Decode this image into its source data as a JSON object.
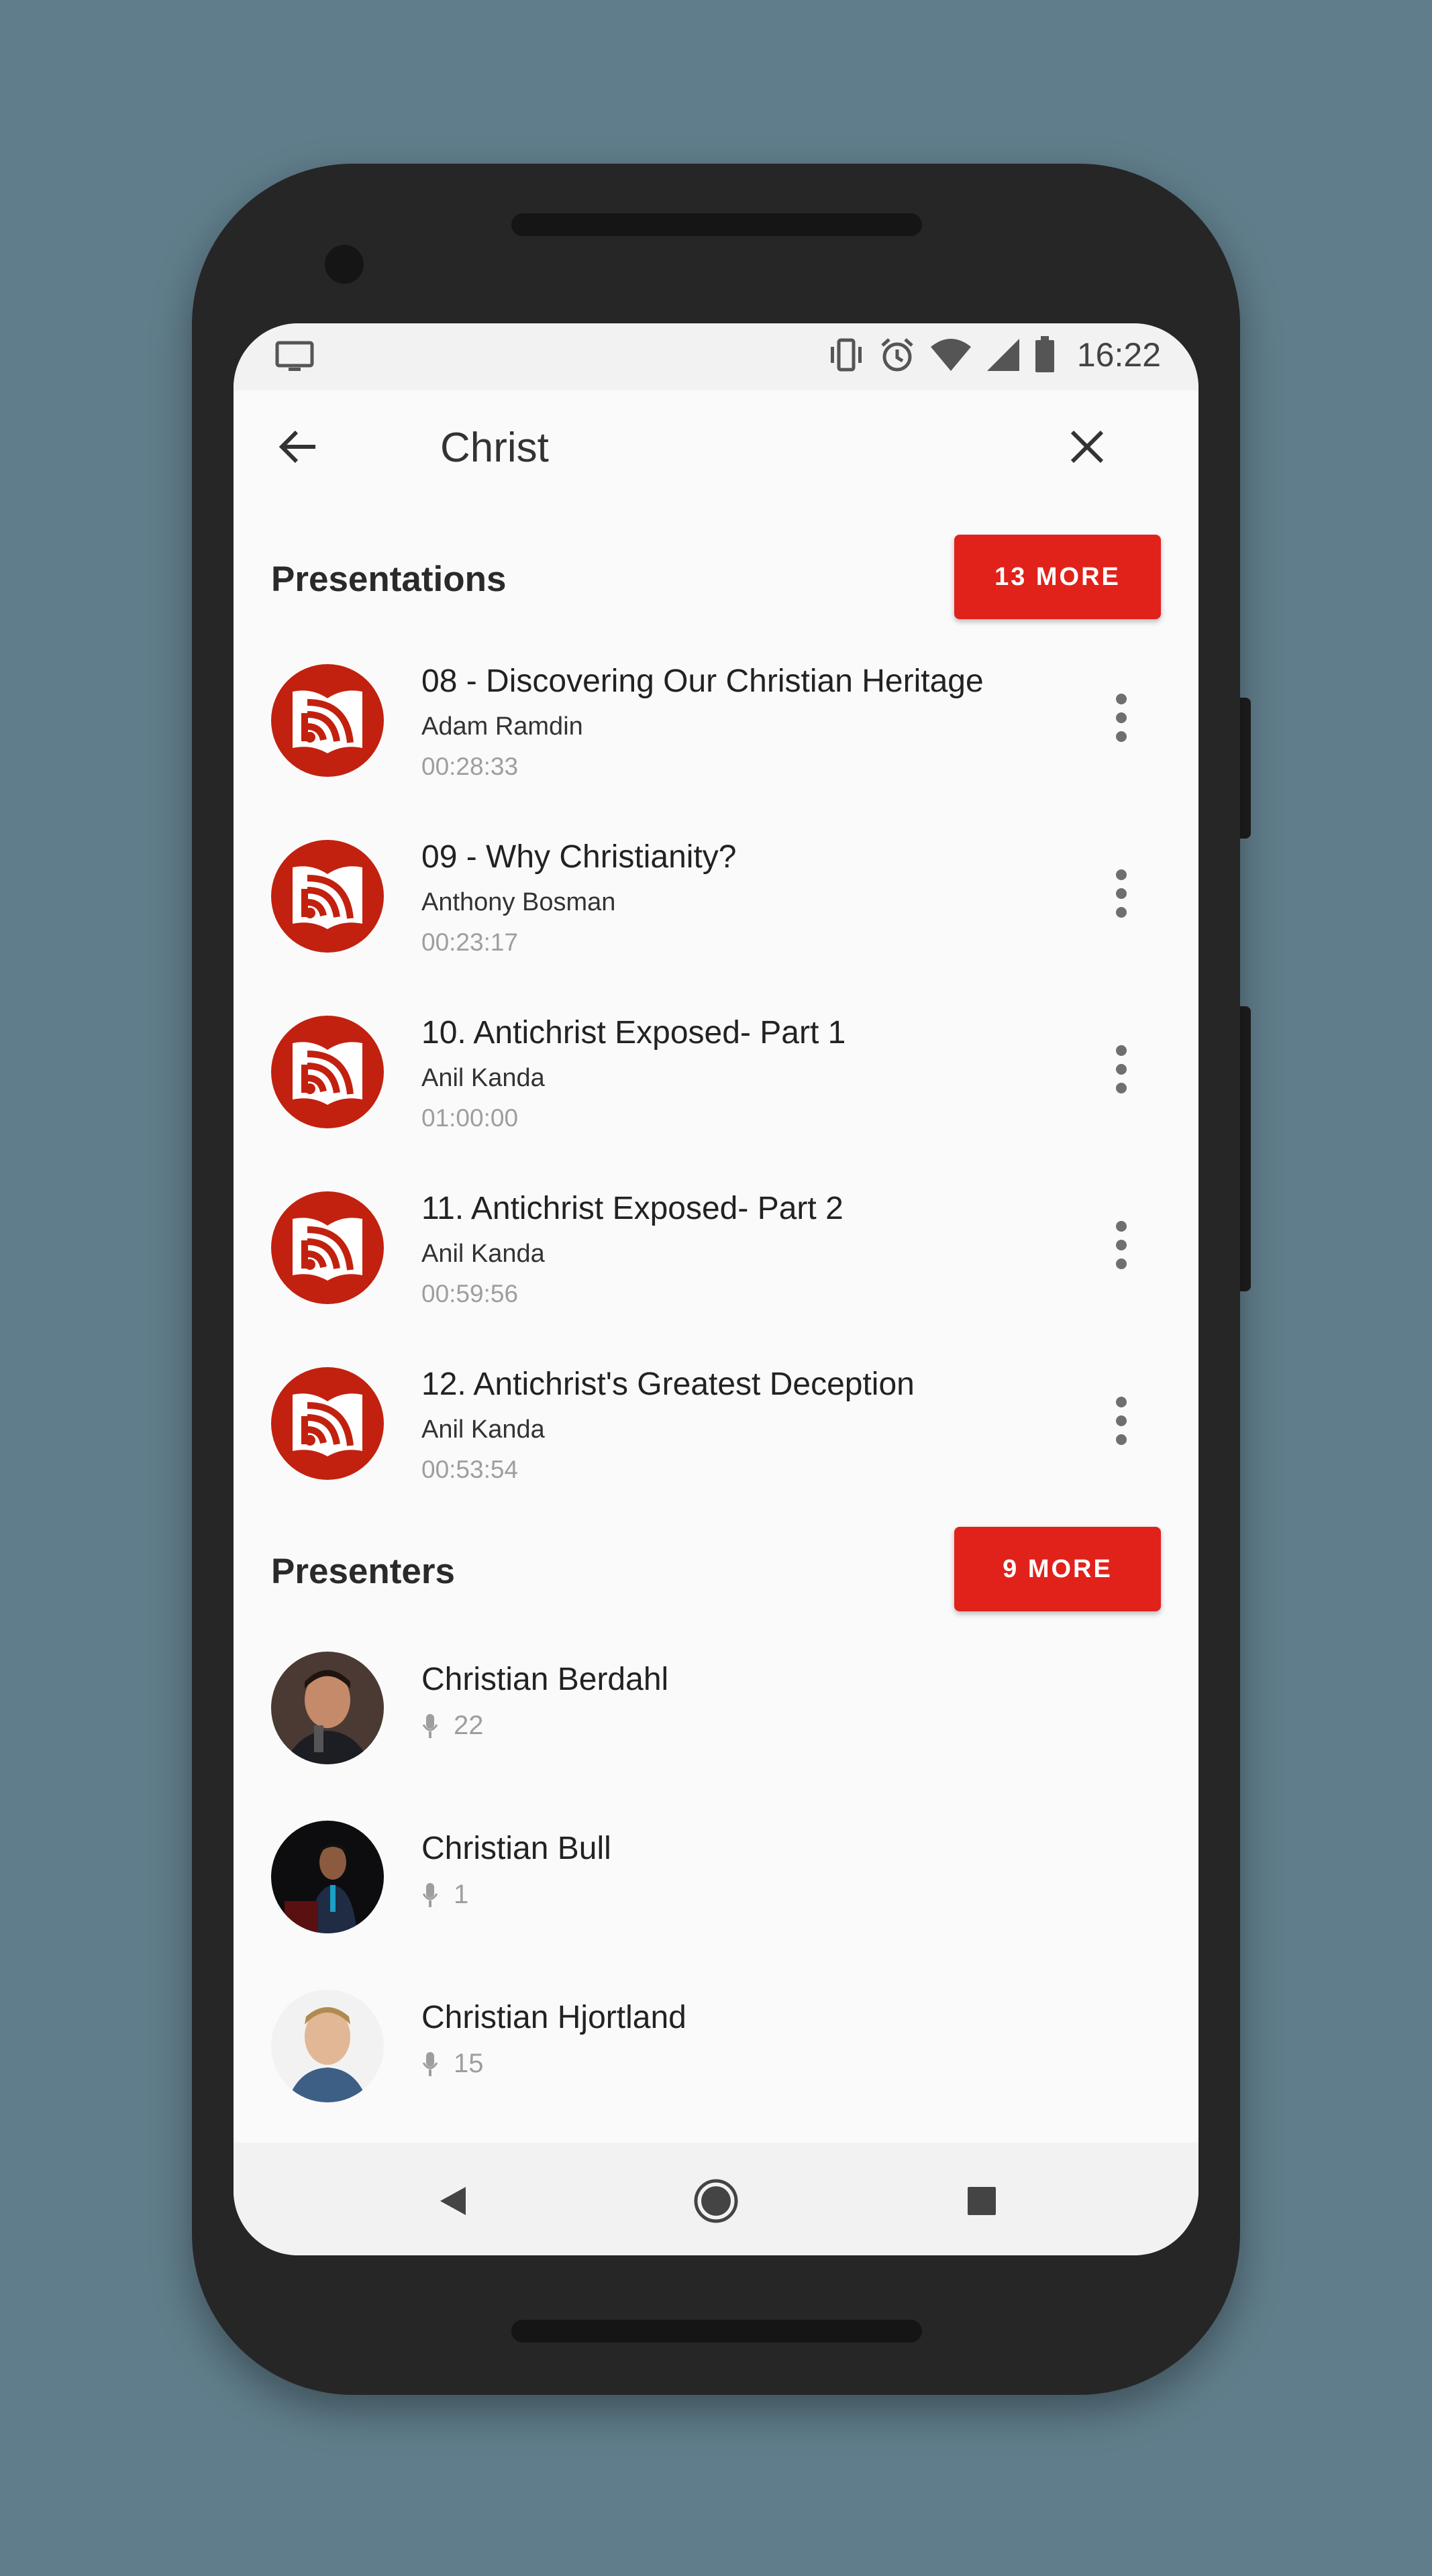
{
  "status_bar": {
    "time": "16:22"
  },
  "search": {
    "query": "Christ"
  },
  "presentations": {
    "title": "Presentations",
    "more_label": "13 MORE",
    "items": [
      {
        "title": "08 - Discovering Our Christian Heritage",
        "author": "Adam Ramdin",
        "duration": "00:28:33"
      },
      {
        "title": "09 - Why Christianity?",
        "author": "Anthony Bosman",
        "duration": "00:23:17"
      },
      {
        "title": "10. Antichrist Exposed- Part 1",
        "author": "Anil Kanda",
        "duration": "01:00:00"
      },
      {
        "title": "11. Antichrist Exposed- Part 2",
        "author": "Anil Kanda",
        "duration": "00:59:56"
      },
      {
        "title": "12. Antichrist's Greatest Deception",
        "author": "Anil Kanda",
        "duration": "00:53:54"
      }
    ]
  },
  "presenters": {
    "title": "Presenters",
    "more_label": "9 MORE",
    "items": [
      {
        "name": "Christian Berdahl",
        "count": "22"
      },
      {
        "name": "Christian Bull",
        "count": "1"
      },
      {
        "name": "Christian Hjortland",
        "count": "15"
      }
    ]
  },
  "colors": {
    "accent": "#e0221b",
    "icon_bg": "#c2210f",
    "backdrop": "#607d8b"
  },
  "icons": {
    "status": [
      "cast-icon",
      "vibrate-icon",
      "alarm-icon",
      "wifi-icon",
      "signal-icon",
      "battery-icon"
    ],
    "presentation": "audio-bible-logo-icon",
    "count": "microphone-icon"
  }
}
